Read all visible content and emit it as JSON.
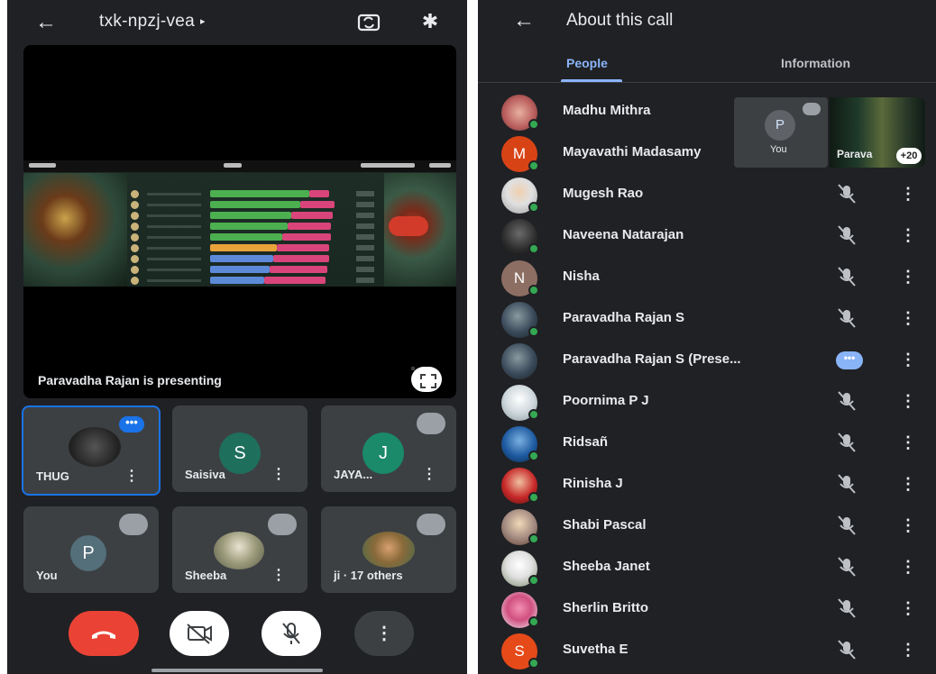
{
  "meeting": {
    "code": "txk-npzj-vea",
    "presenting_text": "Paravadha Rajan is presenting",
    "tiles": [
      {
        "label": "THUG",
        "talking_badge": "•••"
      },
      {
        "label": "Saisiva",
        "avatar_letter": "S",
        "avatar_color": "#1e6f5c"
      },
      {
        "label": "JAYA...",
        "avatar_letter": "J",
        "avatar_color": "#1a8a6a"
      },
      {
        "label": "You",
        "avatar_letter": "P",
        "avatar_color": "#546e7a"
      },
      {
        "label": "Sheeba"
      },
      {
        "label": "ji · 17 others"
      }
    ],
    "more_label": "⋮"
  },
  "controls": {
    "more_label": "⋮"
  },
  "about": {
    "title": "About this call",
    "tabs": [
      "People",
      "Information"
    ],
    "pip_you_letter": "P",
    "pip_you_label": "You",
    "pip_presenter_label": "Parava",
    "pip_count": "+20",
    "presenting_badge": "•••",
    "people": [
      {
        "name": "Madhu Mithra",
        "avatar_color": "#b85c5c"
      },
      {
        "name": "Mayavathi Madasamy",
        "avatar_letter": "M",
        "avatar_color": "#d84315"
      },
      {
        "name": "Mugesh Rao",
        "avatar_color": "#e0e0e0"
      },
      {
        "name": "Naveena Natarajan",
        "avatar_color": "#2b2b2b"
      },
      {
        "name": "Nisha",
        "avatar_letter": "N",
        "avatar_color": "#8d6e63"
      },
      {
        "name": "Paravadha Rajan S",
        "avatar_color": "#3a4a5a"
      },
      {
        "name": "Paravadha Rajan S (Prese...",
        "avatar_color": "#3a4a5a"
      },
      {
        "name": "Poornima P J",
        "avatar_color": "#cfd8dc"
      },
      {
        "name": "Ridsañ",
        "avatar_color": "#1e5aa0"
      },
      {
        "name": "Rinisha J",
        "avatar_color": "#c62828"
      },
      {
        "name": "Shabi Pascal",
        "avatar_color": "#a1887f"
      },
      {
        "name": "Sheeba Janet",
        "avatar_color": "#e0e0e0"
      },
      {
        "name": "Sherlin Britto",
        "avatar_color": "#f48fb1"
      },
      {
        "name": "Suvetha E",
        "avatar_letter": "S",
        "avatar_color": "#e64a19"
      }
    ],
    "kebab": "⋮"
  },
  "colors": {
    "background": "#202124",
    "accent": "#8ab4f8",
    "hangup": "#ea4335",
    "online": "#34a853"
  }
}
